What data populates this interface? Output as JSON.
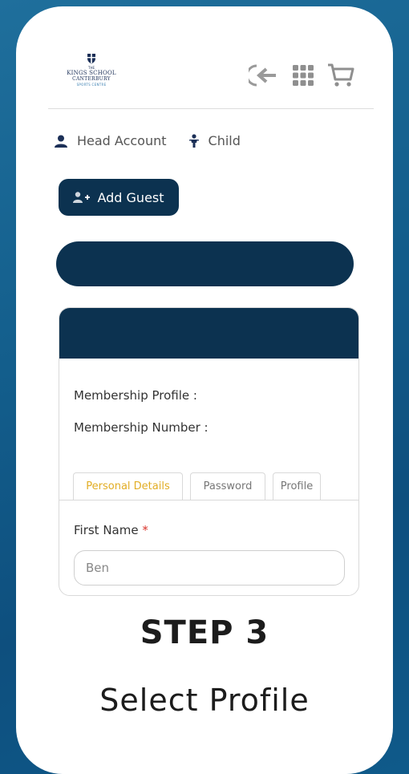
{
  "logo": {
    "line1": "THE",
    "line2": "KINGS SCHOOL",
    "line3": "CANTERBURY",
    "line4": "SPORTS CENTRE",
    "icon": "school-crest-icon"
  },
  "header_icons": [
    "logout-arrow-icon",
    "apps-grid-icon",
    "cart-icon"
  ],
  "account_tabs": {
    "head_account": "Head Account",
    "head_account_icon": "person-icon",
    "child": "Child",
    "child_icon": "child-icon"
  },
  "add_guest": {
    "label": "Add Guest",
    "icon": "add-person-icon"
  },
  "profile_card": {
    "membership_profile_label": "Membership Profile :",
    "membership_number_label": "Membership Number :",
    "tabs": [
      "Personal Details",
      "Password",
      "Profile"
    ],
    "first_name_label": "First Name",
    "required_mark": "*",
    "first_name_value": "Ben"
  },
  "caption": {
    "step": "STEP 3",
    "subtitle": "Select Profile"
  },
  "colors": {
    "navy": "#0c3250",
    "active_tab": "#e2ad24",
    "background_blue": "#135e8c"
  }
}
